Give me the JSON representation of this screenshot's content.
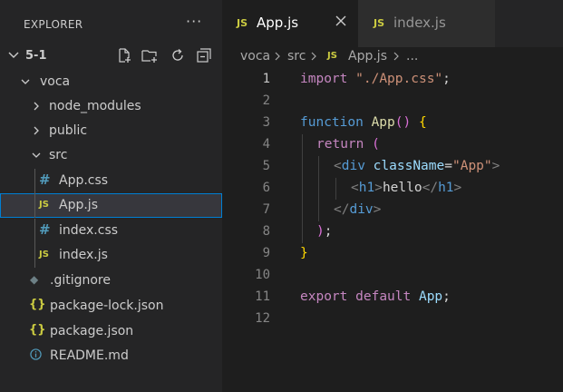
{
  "sidebar": {
    "title": "EXPLORER",
    "more": "···",
    "section": "5-1",
    "tree": [
      {
        "label": "voca",
        "type": "folder",
        "expanded": true,
        "depth": 0
      },
      {
        "label": "node_modules",
        "type": "folder",
        "expanded": false,
        "depth": 1
      },
      {
        "label": "public",
        "type": "folder",
        "expanded": false,
        "depth": 1
      },
      {
        "label": "src",
        "type": "folder",
        "expanded": true,
        "depth": 1
      },
      {
        "label": "App.css",
        "type": "css",
        "depth": 2,
        "icon": "#"
      },
      {
        "label": "App.js",
        "type": "js",
        "depth": 2,
        "icon": "JS",
        "selected": true
      },
      {
        "label": "index.css",
        "type": "css",
        "depth": 2,
        "icon": "#"
      },
      {
        "label": "index.js",
        "type": "js",
        "depth": 2,
        "icon": "JS"
      },
      {
        "label": ".gitignore",
        "type": "git",
        "depth": 1,
        "icon": "◆"
      },
      {
        "label": "package-lock.json",
        "type": "json",
        "depth": 1,
        "icon": "{}"
      },
      {
        "label": "package.json",
        "type": "json",
        "depth": 1,
        "icon": "{}"
      },
      {
        "label": "README.md",
        "type": "info",
        "depth": 1
      }
    ]
  },
  "tabs": [
    {
      "label": "App.js",
      "icon": "JS",
      "active": true
    },
    {
      "label": "index.js",
      "icon": "JS",
      "active": false
    }
  ],
  "breadcrumb": {
    "parts": [
      "voca",
      "src",
      "App.js",
      "..."
    ],
    "file_icon": "JS"
  },
  "editor": {
    "line_numbers": [
      "1",
      "2",
      "3",
      "4",
      "5",
      "6",
      "7",
      "8",
      "9",
      "10",
      "11",
      "12"
    ],
    "current_line": "1",
    "lines": {
      "l1": {
        "kw": "import",
        "str": "\"./App.css\"",
        "end": ";"
      },
      "l3": {
        "kw": "function",
        "name": "App",
        "parens": "()",
        "brace": "{"
      },
      "l4": {
        "kw": "return",
        "paren": "("
      },
      "l5": {
        "open": "<",
        "tag": "div",
        "attr": "className",
        "eq": "=",
        "val": "\"App\"",
        "close": ">"
      },
      "l6": {
        "open": "<",
        "tag": "h1",
        "close": ">",
        "text": "hello",
        "open_end": "</",
        "tag_end": "h1",
        "close_end": ">"
      },
      "l7": {
        "open": "</",
        "tag": "div",
        "close": ">"
      },
      "l8": {
        "paren": ")",
        "end": ";"
      },
      "l9": {
        "brace": "}"
      },
      "l11": {
        "kw1": "export",
        "kw2": "default",
        "name": "App",
        "end": ";"
      }
    }
  },
  "colors": {
    "accent": "#007fd4",
    "js_icon": "#cbcb41",
    "css_icon": "#519aba"
  }
}
